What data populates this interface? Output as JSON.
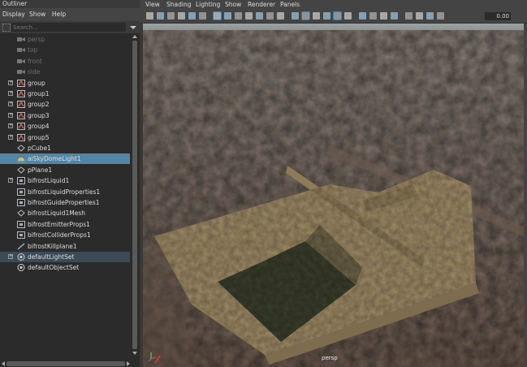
{
  "outliner": {
    "title": "Outliner",
    "menu": [
      "Display",
      "Show",
      "Help"
    ],
    "search_placeholder": "Search...",
    "items": [
      {
        "label": "persp",
        "icon": "camera-icon",
        "dim": true
      },
      {
        "label": "top",
        "icon": "camera-icon",
        "dim": true
      },
      {
        "label": "front",
        "icon": "camera-icon",
        "dim": true
      },
      {
        "label": "side",
        "icon": "camera-icon",
        "dim": true
      },
      {
        "label": "group",
        "icon": "group-icon",
        "expand": true
      },
      {
        "label": "group1",
        "icon": "group-icon",
        "expand": true
      },
      {
        "label": "group2",
        "icon": "group-icon",
        "expand": true
      },
      {
        "label": "group3",
        "icon": "group-icon",
        "expand": true
      },
      {
        "label": "group4",
        "icon": "group-icon",
        "expand": true
      },
      {
        "label": "group5",
        "icon": "group-icon",
        "expand": true
      },
      {
        "label": "pCube1",
        "icon": "mesh-icon"
      },
      {
        "label": "aiSkyDomeLight1",
        "icon": "skydome-light-icon",
        "selected": true
      },
      {
        "label": "pPlane1",
        "icon": "mesh-icon"
      },
      {
        "label": "bifrostLiquid1",
        "icon": "bifrost-icon",
        "expand": true
      },
      {
        "label": "bifrostLiquidProperties1",
        "icon": "bifrost-icon"
      },
      {
        "label": "bifrostGuideProperties1",
        "icon": "bifrost-icon"
      },
      {
        "label": "bifrostLiquid1Mesh",
        "icon": "mesh-icon"
      },
      {
        "label": "bifrostEmitterProps1",
        "icon": "bifrost-icon"
      },
      {
        "label": "bifrostColliderProps1",
        "icon": "bifrost-icon"
      },
      {
        "label": "bifrostKillplane1",
        "icon": "killplane-icon"
      },
      {
        "label": "defaultLightSet",
        "icon": "set-icon",
        "expand": true,
        "highlighted": true
      },
      {
        "label": "defaultObjectSet",
        "icon": "set-icon"
      }
    ]
  },
  "viewport": {
    "menu": [
      "View",
      "Shading",
      "Lighting",
      "Show",
      "Renderer",
      "Panels"
    ],
    "value_field": "0.00",
    "camera_label": "persp"
  },
  "colors": {
    "selection": "#5285a6",
    "ground": "#7a6a5e",
    "platform": "#a08c66",
    "water": "#3b3f2c"
  }
}
